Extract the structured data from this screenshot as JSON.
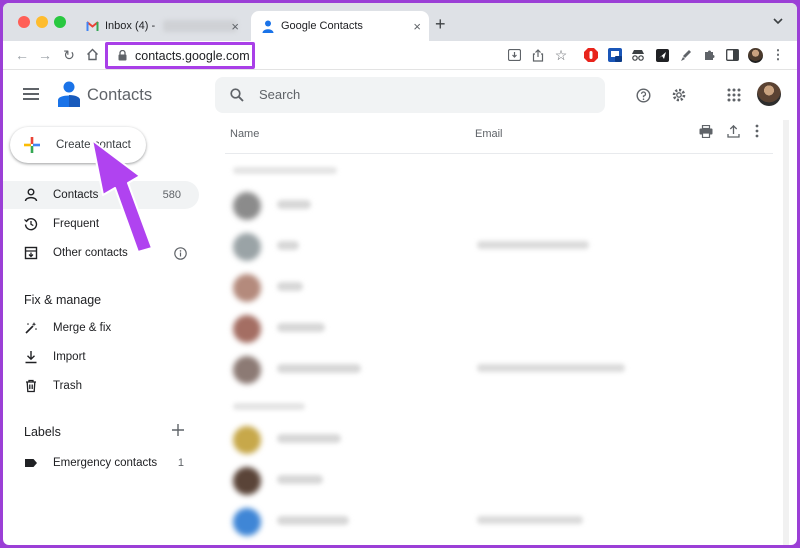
{
  "browser": {
    "tabs": [
      {
        "label": "Inbox (4) -",
        "favicon": "gmail-icon",
        "active": false
      },
      {
        "label": "Google Contacts",
        "favicon": "contacts-icon",
        "active": true
      }
    ],
    "url": "contacts.google.com",
    "highlight_color": "#a93fe8"
  },
  "app": {
    "title": "Contacts",
    "search_placeholder": "Search"
  },
  "sidebar": {
    "create_label": "Create contact",
    "items": [
      {
        "label": "Contacts",
        "count": "580",
        "icon": "person-icon",
        "selected": true
      },
      {
        "label": "Frequent",
        "icon": "history-icon"
      },
      {
        "label": "Other contacts",
        "icon": "archive-icon"
      }
    ],
    "fix_manage": {
      "title": "Fix & manage",
      "items": [
        {
          "label": "Merge & fix",
          "icon": "magic-wand-icon"
        },
        {
          "label": "Import",
          "icon": "download-icon"
        },
        {
          "label": "Trash",
          "icon": "trash-icon"
        }
      ]
    },
    "labels": {
      "title": "Labels",
      "items": [
        {
          "label": "Emergency contacts",
          "count": "1",
          "icon": "label-icon"
        }
      ]
    }
  },
  "list": {
    "columns": {
      "name": "Name",
      "email": "Email"
    }
  },
  "colors": {
    "accent": "#a93fe8",
    "contacts_blue": "#1a73e8"
  }
}
